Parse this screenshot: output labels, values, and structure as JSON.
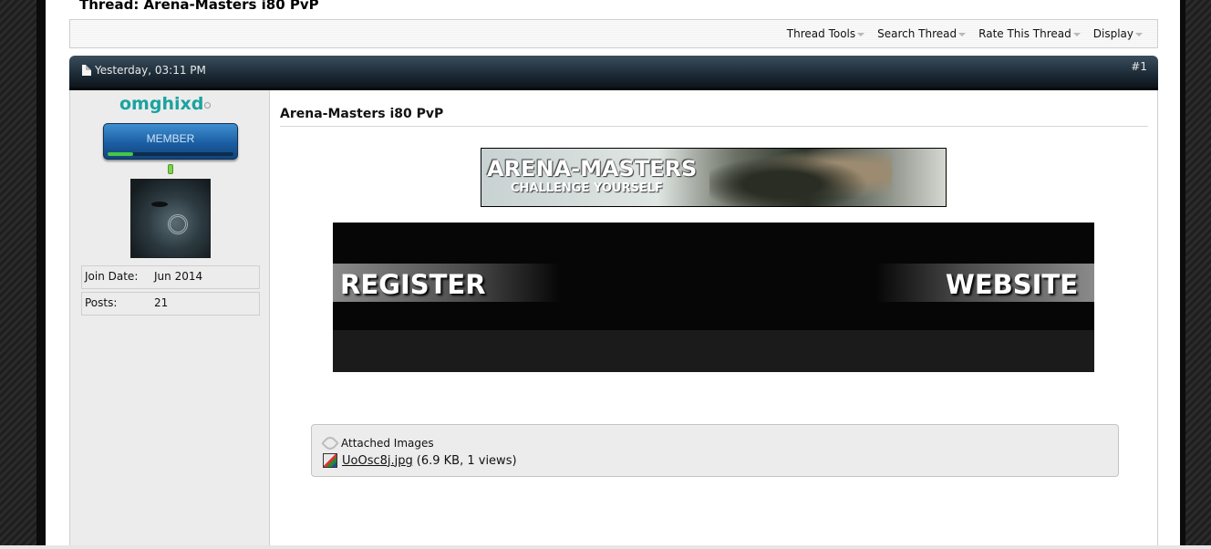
{
  "thread": {
    "title": "Thread: Arena-Masters i80 PvP"
  },
  "toolbar": {
    "items": [
      {
        "label": "Thread Tools"
      },
      {
        "label": "Search Thread"
      },
      {
        "label": "Rate This Thread"
      },
      {
        "label": "Display"
      }
    ]
  },
  "post": {
    "date": "Yesterday, 03:11 PM",
    "number": "#1",
    "title": "Arena-Masters i80 PvP",
    "banner": {
      "line1": "ARENA-MASTERS",
      "line2": "CHALLENGE YOURSELF"
    },
    "links": {
      "register": "REGISTER",
      "website": "WEBSITE"
    }
  },
  "user": {
    "name": "omghixd",
    "name_color": "#1aa3a0",
    "rank": "MEMBER",
    "rank_progress": 0.2,
    "stats": [
      {
        "label": "Join Date:",
        "value": "Jun 2014"
      },
      {
        "label": "Posts:",
        "value": "21"
      }
    ]
  },
  "attachments": {
    "heading": "Attached Images",
    "files": [
      {
        "name": "UoOsc8j.jpg",
        "meta": "(6.9 KB, 1 views)",
        "icon": "image-file-icon"
      }
    ]
  }
}
